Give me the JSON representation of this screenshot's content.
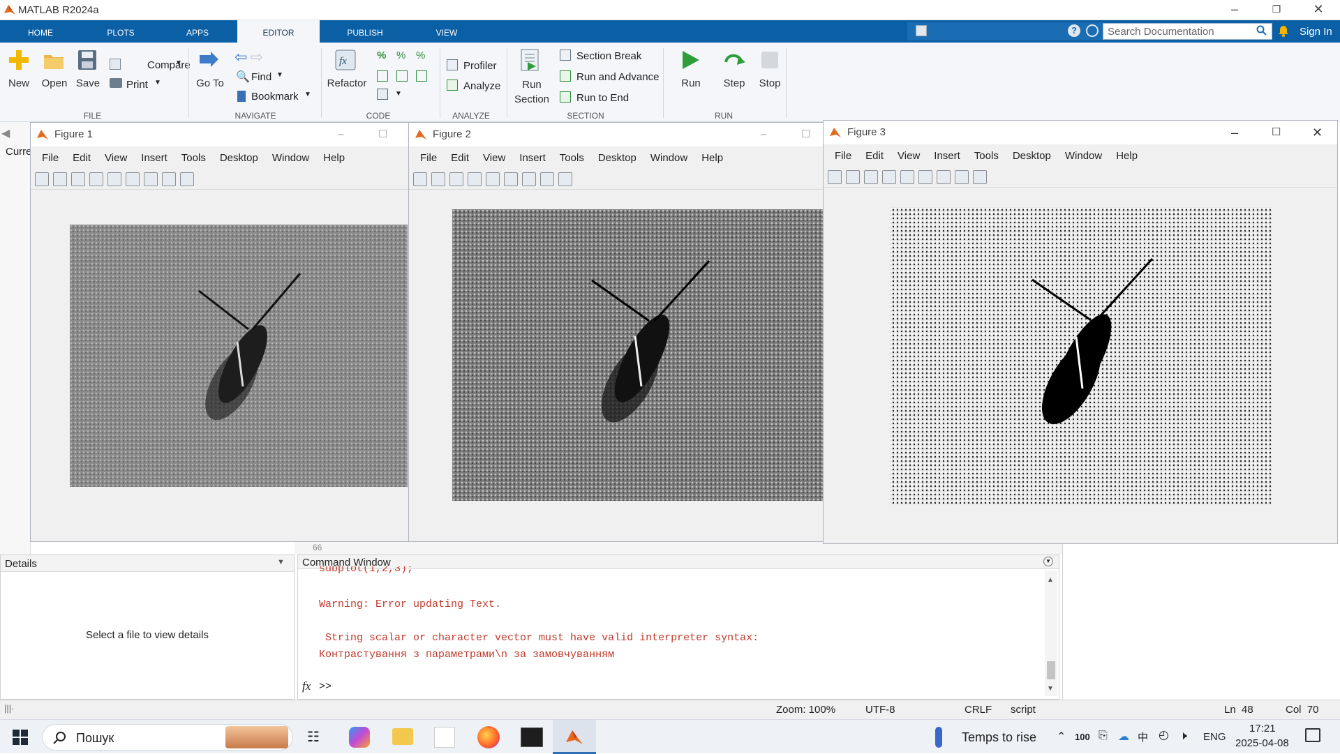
{
  "app": {
    "title": "MATLAB R2024a"
  },
  "tabs": [
    {
      "label": "HOME"
    },
    {
      "label": "PLOTS"
    },
    {
      "label": "APPS"
    },
    {
      "label": "EDITOR"
    },
    {
      "label": "PUBLISH"
    },
    {
      "label": "VIEW"
    }
  ],
  "search": {
    "placeholder": "Search Documentation"
  },
  "signin": "Sign In",
  "ribbon": {
    "new": "New",
    "open": "Open",
    "save": "Save",
    "compare": "Compare",
    "print": "Print",
    "goto": "Go To",
    "find": "Find",
    "bookmark": "Bookmark",
    "refactor": "Refactor",
    "profiler": "Profiler",
    "analyze": "Analyze",
    "run_section": "Run Section",
    "section_break": "Section Break",
    "run_advance": "Run and Advance",
    "run_end": "Run to End",
    "run": "Run",
    "step": "Step",
    "stop": "Stop",
    "groups": {
      "file": "FILE",
      "navigate": "NAVIGATE",
      "code": "CODE",
      "analyze": "ANALYZE",
      "section": "SECTION",
      "run": "RUN"
    }
  },
  "figure_menu": [
    "File",
    "Edit",
    "View",
    "Insert",
    "Tools",
    "Desktop",
    "Window",
    "Help"
  ],
  "figures": [
    {
      "title": "Figure 1"
    },
    {
      "title": "Figure 2"
    },
    {
      "title": "Figure 3"
    }
  ],
  "current_folder_label": "Curre",
  "details": {
    "header": "Details",
    "empty": "Select a file to view details"
  },
  "editor_line": "66",
  "command_window": {
    "title": "Command Window",
    "lines": [
      "subplot(1,2,3);",
      "Warning: Error updating Text.",
      " String scalar or character vector must have valid interpreter syntax:",
      "Контрастування з параметрами\\n за замовчуванням"
    ],
    "prompt": ">>",
    "fx": "fx"
  },
  "status": {
    "zoom": "Zoom: 100%",
    "encoding": "UTF-8",
    "eol": "CRLF",
    "type": "script",
    "ln": "Ln  48",
    "col": "Col  70"
  },
  "taskbar": {
    "search": "Пошук",
    "weather": "Temps to rise",
    "battery": "100",
    "lang": "ENG",
    "time": "17:21",
    "date": "2025-04-08"
  },
  "colors": {
    "accent": "#0b5fa5",
    "warning": "#c0392b",
    "ribbon_bg": "#f4f6f9"
  }
}
